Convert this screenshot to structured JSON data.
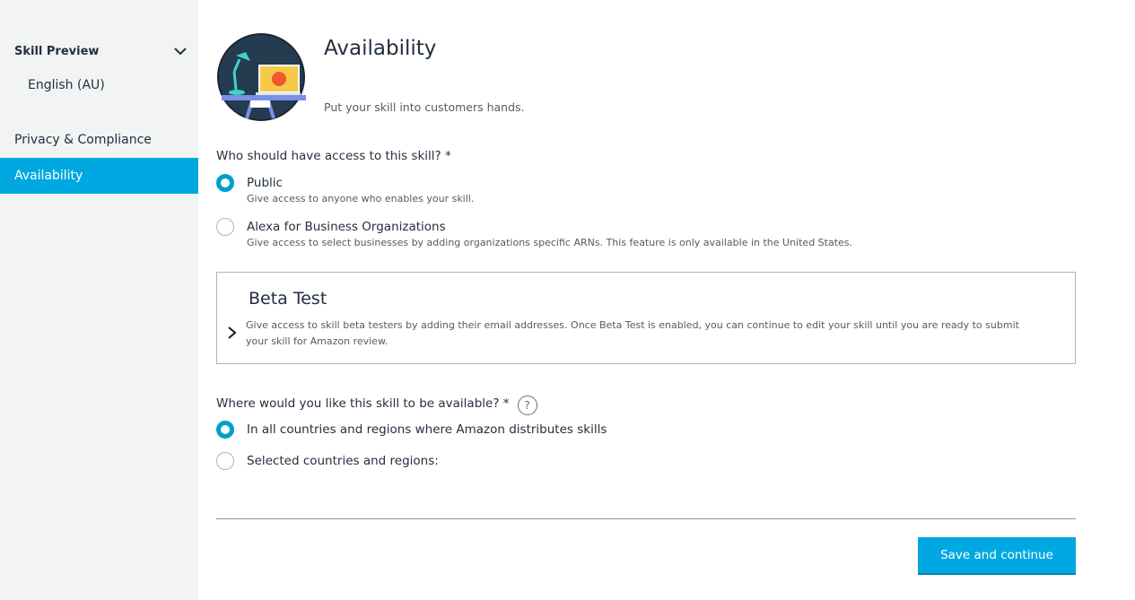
{
  "sidebar": {
    "section_label": "Skill Preview",
    "locale": "English (AU)",
    "items": [
      {
        "label": "Privacy & Compliance"
      },
      {
        "label": "Availability",
        "active": true
      }
    ]
  },
  "header": {
    "title": "Availability",
    "subtitle": "Put your skill into customers hands."
  },
  "access": {
    "question": "Who should have access to this skill? *",
    "options": [
      {
        "label": "Public",
        "desc": "Give access to anyone who enables your skill.",
        "checked": true
      },
      {
        "label": "Alexa for Business Organizations",
        "desc": "Give access to select businesses by adding organizations specific ARNs. This feature is only available in the United States.",
        "checked": false
      }
    ]
  },
  "beta": {
    "title": "Beta Test",
    "desc": "Give access to skill beta testers by adding their email addresses. Once Beta Test is enabled, you can continue to edit your skill until you are ready to submit your skill for Amazon review."
  },
  "region": {
    "question": "Where would you like this skill to be available?  *",
    "help": "?",
    "options": [
      {
        "label": "In all countries and regions where Amazon distributes skills",
        "checked": true
      },
      {
        "label": "Selected countries and regions:",
        "checked": false
      }
    ]
  },
  "footer": {
    "save_label": "Save and continue"
  },
  "colors": {
    "accent": "#00a8e1",
    "sidebar_bg": "#f2f4f4",
    "text": "#232f3e"
  }
}
